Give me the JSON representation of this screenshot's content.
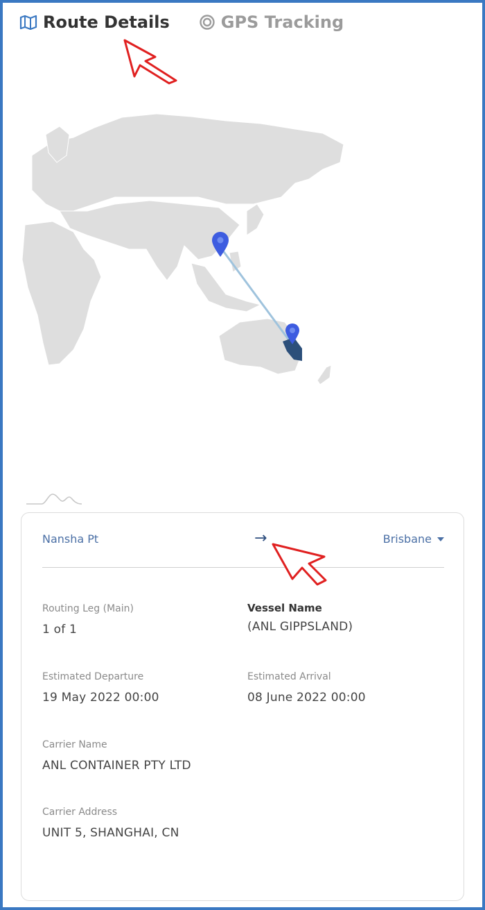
{
  "tabs": [
    {
      "label": "Route Details",
      "icon": "map-icon",
      "active": true
    },
    {
      "label": "GPS Tracking",
      "icon": "target-icon",
      "active": false
    }
  ],
  "route": {
    "origin": "Nansha Pt",
    "destination": "Brisbane"
  },
  "details": {
    "routing_leg_label": "Routing Leg (Main)",
    "routing_leg_value": "1 of 1",
    "vessel_label": "Vessel Name",
    "vessel_value": "(ANL GIPPSLAND)",
    "departure_label": "Estimated Departure",
    "departure_value": "19 May 2022 00:00",
    "arrival_label": "Estimated Arrival",
    "arrival_value": "08 June 2022 00:00",
    "carrier_name_label": "Carrier Name",
    "carrier_name_value": "ANL CONTAINER PTY LTD",
    "carrier_address_label": "Carrier Address",
    "carrier_address_value": "UNIT 5, SHANGHAI, CN"
  },
  "colors": {
    "accent": "#3a78c2",
    "pin": "#3d5ce0",
    "route_line": "#9fc3dd",
    "land": "#dedede"
  }
}
